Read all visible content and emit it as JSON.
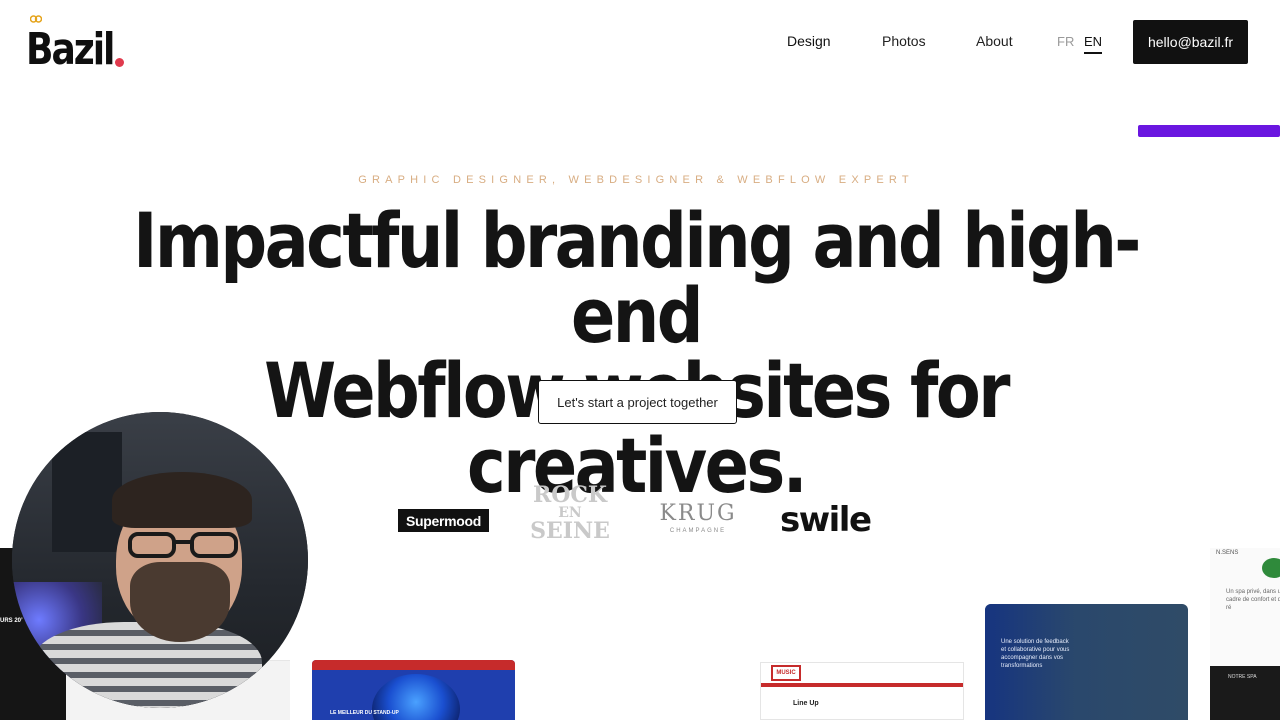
{
  "header": {
    "logo_text": "Bazil",
    "nav": [
      {
        "label": "Design"
      },
      {
        "label": "Photos"
      },
      {
        "label": "About"
      }
    ],
    "languages": [
      "FR",
      "EN"
    ],
    "active_language": "EN",
    "email_button": "hello@bazil.fr"
  },
  "hero": {
    "eyebrow": "GRAPHIC DESIGNER, WEBDESIGNER & WEBFLOW EXPERT",
    "headline_line1": "Impactful branding and high-end",
    "headline_line2": "Webflow websites for creatives.",
    "cta": "Let's start a project together"
  },
  "clients": {
    "supermood": "Supermood",
    "rock_line1": "ROCK",
    "rock_line2": "EN",
    "rock_line3": "SEINE",
    "krug_name": "KRUG",
    "krug_sub": "CHAMPAGNE",
    "swile": "swile"
  },
  "previews": {
    "left_strip_text": "URS 20’",
    "blue_caption": "LE MEILLEUR DU STAND-UP",
    "lineup_label": "Line Up",
    "lineup_stamp": "MUSIC",
    "team_text": "Une solution de feedback et collaborative pour vous accompagner dans vos transformations",
    "spa_heading": "N.SENS",
    "spa_text": "Un spa privé, dans un cadre de confort et de ré",
    "spa_dark": "NOTRE SPA"
  },
  "colors": {
    "accent_purple": "#6a16e0",
    "eyebrow_tan": "#d8ad82",
    "logo_dot": "#e03a4d",
    "button_dark": "#111111"
  }
}
